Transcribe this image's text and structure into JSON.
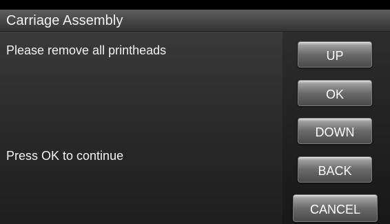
{
  "header": {
    "title": "Carriage Assembly"
  },
  "messages": {
    "instruction": "Please remove all printheads",
    "prompt": "Press OK to continue"
  },
  "buttons": {
    "up": "UP",
    "ok": "OK",
    "down": "DOWN",
    "back": "BACK",
    "cancel": "CANCEL"
  }
}
